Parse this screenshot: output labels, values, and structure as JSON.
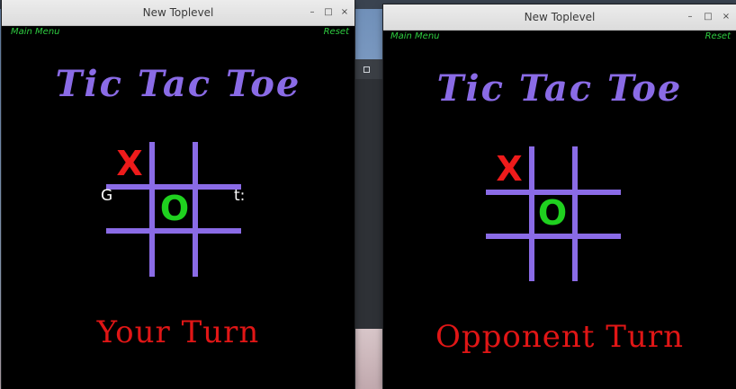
{
  "colors": {
    "grid": "#8a6be6",
    "title": "#8a6be6",
    "x_mark": "#ee1b1b",
    "o_mark": "#1fd11f",
    "turn_text": "#e01616",
    "menu_text": "#2ecc40",
    "window_bg": "#000000"
  },
  "windows": [
    {
      "title": "New Toplevel",
      "controls": [
        "–",
        "□",
        "×"
      ],
      "menu_left": "Main Menu",
      "menu_right": "Reset",
      "game_title": "Tic Tac Toe",
      "board": [
        [
          "X",
          "",
          ""
        ],
        [
          "",
          "O",
          ""
        ],
        [
          "",
          "",
          ""
        ]
      ],
      "overlay_left": "G",
      "overlay_right": "t:",
      "status": "Your Turn"
    },
    {
      "title": "New Toplevel",
      "controls": [
        "–",
        "□",
        "×"
      ],
      "menu_left": "Main Menu",
      "menu_right": "Reset",
      "game_title": "Tic Tac Toe",
      "board": [
        [
          "X",
          "",
          ""
        ],
        [
          "",
          "O",
          ""
        ],
        [
          "",
          "",
          ""
        ]
      ],
      "status": "Opponent Turn"
    }
  ],
  "icons": {
    "minimize": "minimize-icon",
    "maximize": "maximize-icon",
    "close": "close-icon"
  }
}
